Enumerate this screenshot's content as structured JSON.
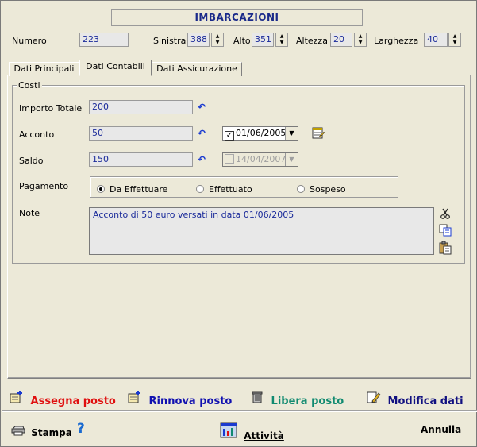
{
  "title": "IMBARCAZIONI",
  "header": {
    "numero_label": "Numero",
    "numero_value": "223",
    "sinistra_label": "Sinistra",
    "sinistra_value": "388",
    "alto_label": "Alto",
    "alto_value": "351",
    "altezza_label": "Altezza",
    "altezza_value": "20",
    "larghezza_label": "Larghezza",
    "larghezza_value": "40"
  },
  "tabs": [
    {
      "label": "Dati Principali",
      "active": false
    },
    {
      "label": "Dati Contabili",
      "active": true
    },
    {
      "label": "Dati Assicurazione",
      "active": false
    }
  ],
  "costi": {
    "group_title": "Costi",
    "importo_label": "Importo Totale",
    "importo_value": "200",
    "acconto_label": "Acconto",
    "acconto_value": "50",
    "acconto_date": "01/06/2005",
    "acconto_date_checked": true,
    "saldo_label": "Saldo",
    "saldo_value": "150",
    "saldo_date": "14/04/2007",
    "saldo_date_checked": false,
    "pagamento_label": "Pagamento",
    "pagamento_options": [
      "Da Effettuare",
      "Effettuato",
      "Sospeso"
    ],
    "pagamento_selected": "Da Effettuare",
    "note_label": "Note",
    "note_value": "Acconto di 50 euro versati in data 01/06/2005"
  },
  "actions": {
    "assegna": "Assegna posto",
    "rinnova": "Rinnova posto",
    "libera": "Libera posto",
    "modifica": "Modifica dati"
  },
  "footer": {
    "stampa": "Stampa",
    "help": "?",
    "attivita": "Attività",
    "annulla": "Annulla"
  },
  "colors": {
    "assegna": "#e01010",
    "rinnova": "#1010b0",
    "libera": "#108a70",
    "modifica": "#101080",
    "field_text": "#1a2a9a"
  }
}
